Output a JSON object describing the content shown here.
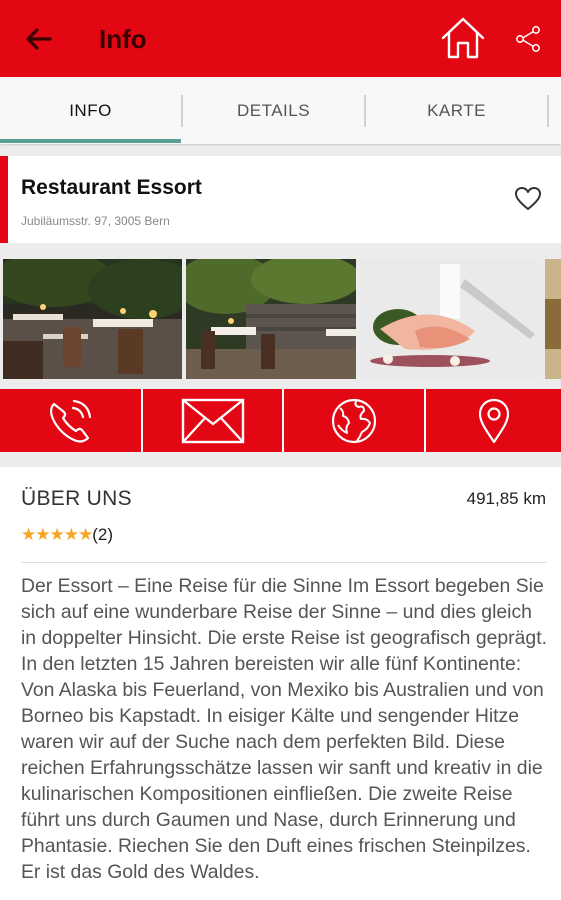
{
  "appbar": {
    "title": "Info"
  },
  "tabs": [
    {
      "label": "INFO"
    },
    {
      "label": "DETAILS"
    },
    {
      "label": "KARTE"
    }
  ],
  "restaurant": {
    "name": "Restaurant Essort",
    "address": "Jubiläumsstr. 97, 3005 Bern"
  },
  "about": {
    "heading": "ÜBER UNS",
    "distance": "491,85 km",
    "stars": "★★★★★",
    "rating_count": "(2)",
    "description": "Der Essort – Eine Reise für die Sinne Im Essort begeben Sie sich auf eine wunderbare Reise der Sinne – und dies gleich in doppelter Hinsicht. Die erste Reise ist geografisch geprägt. In den letzten 15 Jahren bereisten wir alle fünf Kontinente: Von Alaska bis Feuerland, von Mexiko bis Australien und von Borneo bis Kapstadt. In eisiger Kälte und sengender Hitze waren wir auf der Suche nach dem perfekten Bild. Diese reichen Erfahrungsschätze lassen wir sanft und kreativ in die kulinarischen Kompositionen einfließen. Die zweite Reise führt uns durch Gaumen und Nase, durch Erinnerung und Phantasie. Riechen Sie den Duft eines frischen Steinpilzes. Er ist das Gold des Waldes."
  },
  "icons": {
    "back": "arrow-left-icon",
    "home": "home-icon",
    "share": "share-icon",
    "favorite": "heart-icon",
    "actions": [
      "phone-icon",
      "mail-icon",
      "globe-icon",
      "location-pin-icon"
    ]
  },
  "colors": {
    "primary": "#e30613",
    "accent": "#5a9e94",
    "star": "#f5a623"
  }
}
